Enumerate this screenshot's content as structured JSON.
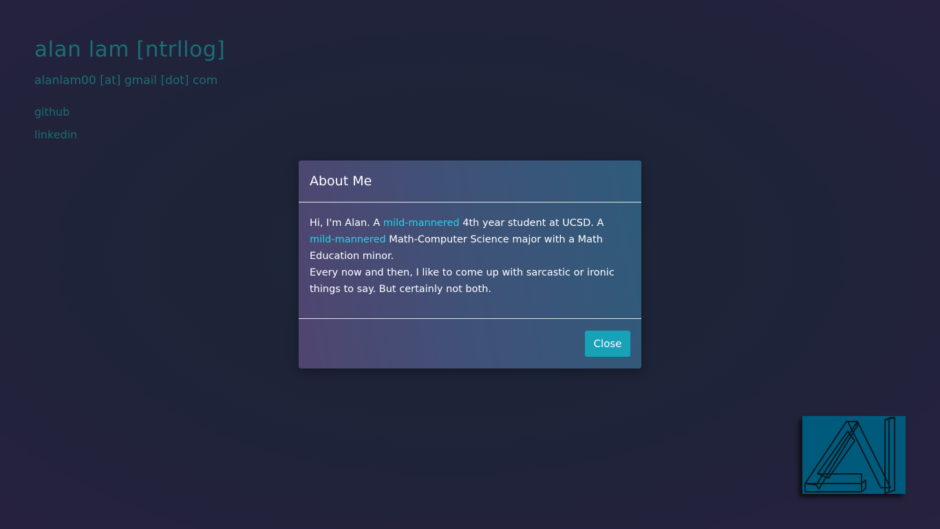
{
  "header": {
    "title": "alan lam [ntrllog]",
    "email": "alanlam00 [at] gmail [dot] com",
    "links": [
      {
        "label": "github"
      },
      {
        "label": "linkedin"
      }
    ]
  },
  "modal": {
    "title": "About Me",
    "body": {
      "p1_intro": "Hi, I'm Alan. A ",
      "highlight1": "mild-mannered",
      "p1_mid": " 4th year student at UCSD. A ",
      "highlight2": "mild-mannered",
      "p1_end": " Math-Computer Science major with a Math Education minor.",
      "p2": "Every now and then, I like to come up with sarcastic or ironic things to say. But certainly not both."
    },
    "close_label": "Close"
  },
  "colors": {
    "accent_text": "#1a6e74",
    "highlight": "#23d5e8",
    "button": "#17a2b8",
    "logo_bg": "#005a7c"
  },
  "icons": {
    "logo": "an-impossible-triangle-logo"
  }
}
